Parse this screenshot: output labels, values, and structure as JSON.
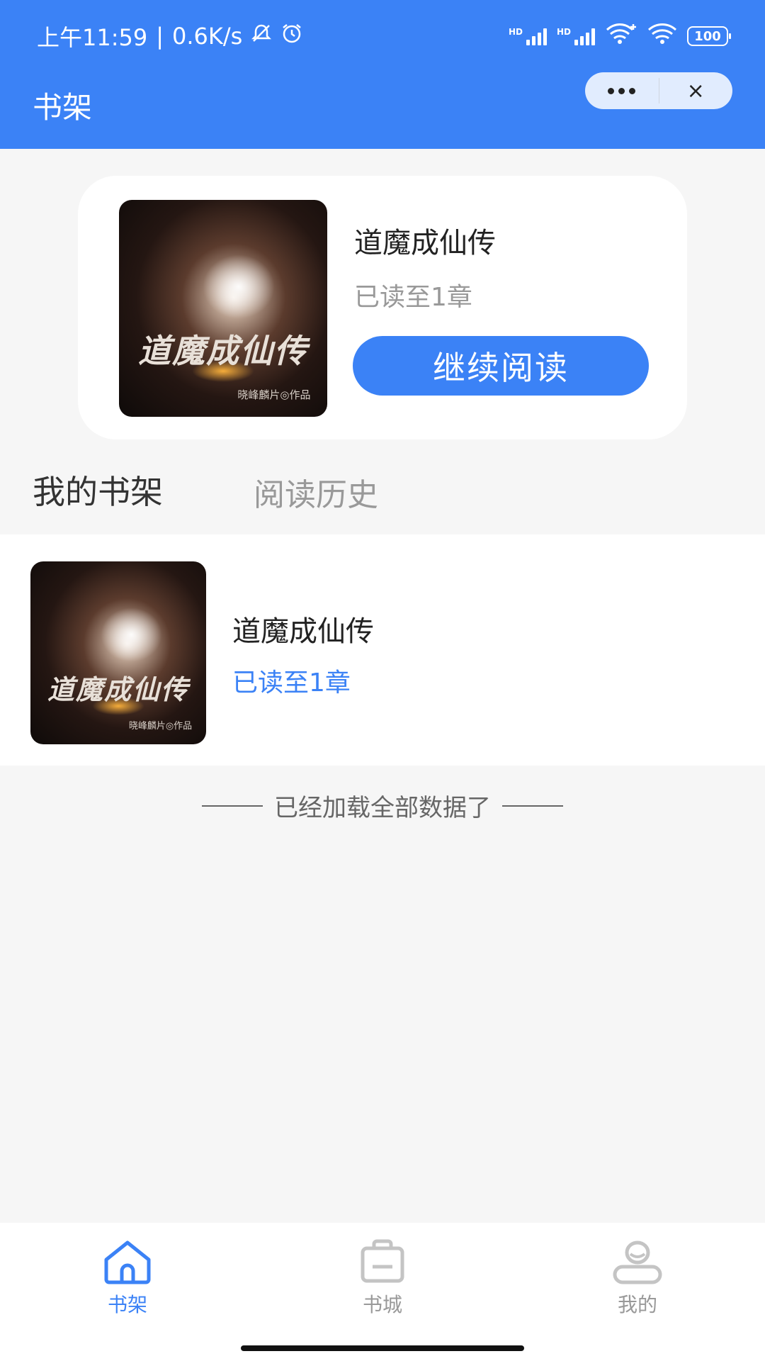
{
  "status_bar": {
    "time": "上午11:59",
    "net_speed": "0.6K/s",
    "battery": "100",
    "hd1": "HD",
    "hd2": "HD"
  },
  "header": {
    "title": "书架",
    "menu_icon": "more-dots-icon",
    "close_icon": "close-icon",
    "close_label": "×"
  },
  "recent": {
    "book_title": "道魔成仙传",
    "progress": "已读至1章",
    "continue_label": "继续阅读",
    "cover_title": "道魔成仙传",
    "cover_author": "晓峰麟片◎作品"
  },
  "tabs": [
    {
      "label": "我的书架",
      "active": true
    },
    {
      "label": "阅读历史",
      "active": false
    }
  ],
  "books": [
    {
      "title": "道魔成仙传",
      "progress": "已读至1章",
      "cover_title": "道魔成仙传",
      "cover_author": "晓峰麟片◎作品"
    }
  ],
  "end_hint": "已经加载全部数据了",
  "bottom_nav": [
    {
      "label": "书架",
      "icon": "home-icon",
      "active": true
    },
    {
      "label": "书城",
      "icon": "shopping-bag-icon",
      "active": false
    },
    {
      "label": "我的",
      "icon": "user-icon",
      "active": false
    }
  ],
  "colors": {
    "primary": "#3b82f6",
    "background": "#f6f6f6",
    "muted": "#999999"
  }
}
